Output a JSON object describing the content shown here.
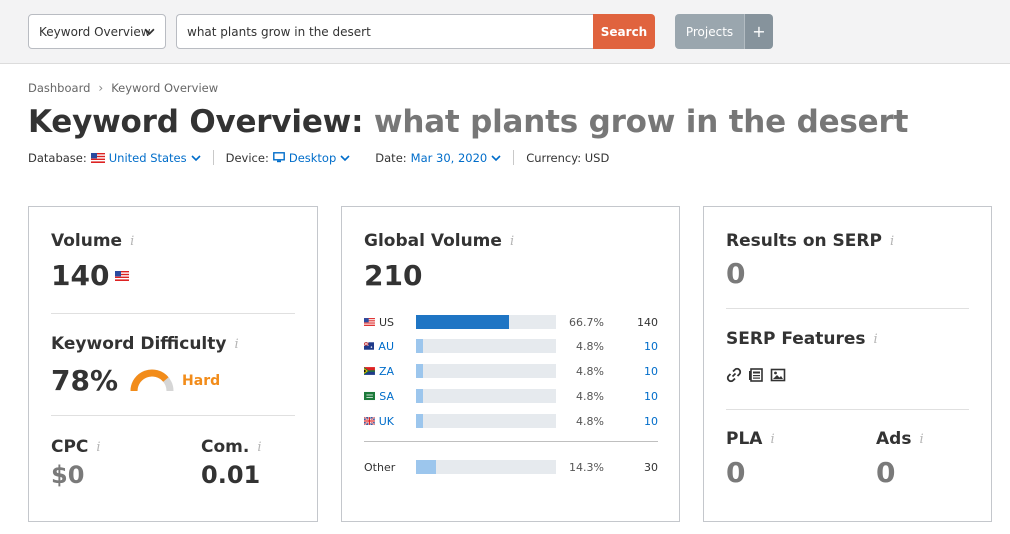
{
  "topbar": {
    "tool_select": "Keyword Overview",
    "search_value": "what plants grow in the desert",
    "search_button": "Search",
    "projects_button": "Projects",
    "projects_plus": "+"
  },
  "breadcrumb": {
    "items": [
      "Dashboard",
      "Keyword Overview"
    ],
    "separator": "›"
  },
  "title": {
    "prefix": "Keyword Overview:",
    "keyword": "what plants grow in the desert"
  },
  "filters": {
    "database_label": "Database:",
    "database_value": "United States",
    "device_label": "Device:",
    "device_value": "Desktop",
    "date_label": "Date:",
    "date_value": "Mar 30, 2020",
    "currency": "Currency: USD"
  },
  "card_volume": {
    "volume_label": "Volume",
    "volume_value": "140",
    "kd_label": "Keyword Difficulty",
    "kd_value": "78%",
    "kd_level": "Hard",
    "kd_fraction": 0.78,
    "cpc_label": "CPC",
    "cpc_value": "$0",
    "com_label": "Com.",
    "com_value": "0.01"
  },
  "card_global": {
    "label": "Global Volume",
    "value": "210",
    "rows": [
      {
        "code": "US",
        "pct": "66.7%",
        "value": "140",
        "share": 0.667,
        "link": false
      },
      {
        "code": "AU",
        "pct": "4.8%",
        "value": "10",
        "share": 0.048,
        "link": true
      },
      {
        "code": "ZA",
        "pct": "4.8%",
        "value": "10",
        "share": 0.048,
        "link": true
      },
      {
        "code": "SA",
        "pct": "4.8%",
        "value": "10",
        "share": 0.048,
        "link": true
      },
      {
        "code": "UK",
        "pct": "4.8%",
        "value": "10",
        "share": 0.048,
        "link": true
      }
    ],
    "other": {
      "code": "Other",
      "pct": "14.3%",
      "value": "30",
      "share": 0.143
    }
  },
  "card_serp": {
    "results_label": "Results on SERP",
    "results_value": "0",
    "features_label": "SERP Features",
    "features_icons": [
      "link-icon",
      "news-icon",
      "image-icon"
    ],
    "pla_label": "PLA",
    "pla_value": "0",
    "ads_label": "Ads",
    "ads_value": "0"
  },
  "colors": {
    "accent_blue": "#006dca",
    "search_orange": "#e0633e",
    "hard_orange": "#f28c1a",
    "bar_blue": "#1f75c4"
  }
}
